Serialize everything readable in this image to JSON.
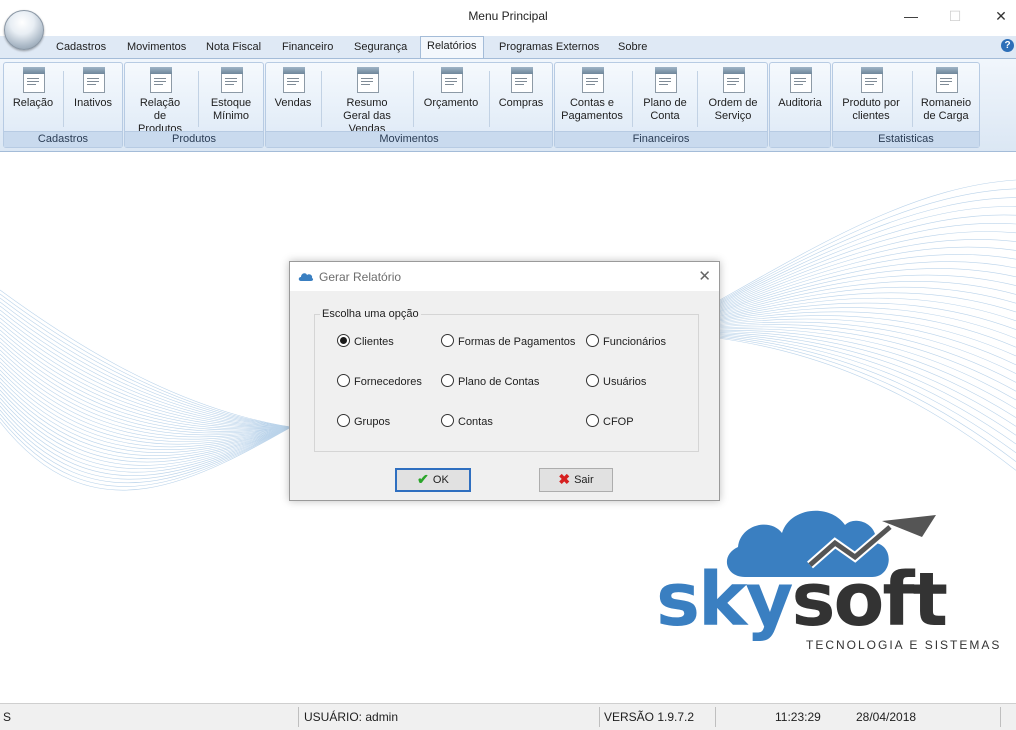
{
  "window": {
    "title": "Menu Principal"
  },
  "colors": {
    "ribbon_blue": "#dfe9f5",
    "logo_blue": "#3a7fc1",
    "logo_dark": "#333333",
    "ok_check": "#2aa52a",
    "sair_x": "#d62020"
  },
  "tabs": [
    "Cadastros",
    "Movimentos",
    "Nota Fiscal",
    "Financeiro",
    "Segurança",
    "Relatórios",
    "Programas Externos",
    "Sobre"
  ],
  "active_tab": "Relatórios",
  "ribbon": {
    "groups": [
      {
        "label": "Cadastros",
        "buttons": [
          {
            "label": "Relação"
          },
          {
            "label": "Inativos"
          }
        ]
      },
      {
        "label": "Produtos",
        "buttons": [
          {
            "label": "Relação de Produtos"
          },
          {
            "label": "Estoque Mínimo"
          }
        ]
      },
      {
        "label": "Movimentos",
        "buttons": [
          {
            "label": "Vendas"
          },
          {
            "label": "Resumo Geral das Vendas"
          },
          {
            "label": "Orçamento"
          },
          {
            "label": "Compras"
          }
        ]
      },
      {
        "label": "Financeiros",
        "buttons": [
          {
            "label": "Contas e Pagamentos"
          },
          {
            "label": "Plano de Conta"
          },
          {
            "label": "Ordem de Serviço"
          }
        ]
      },
      {
        "label": "",
        "buttons": [
          {
            "label": "Auditoria"
          }
        ]
      },
      {
        "label": "Estatisticas",
        "buttons": [
          {
            "label": "Produto por clientes"
          },
          {
            "label": "Romaneio de Carga"
          }
        ]
      }
    ]
  },
  "dialog": {
    "title": "Gerar Relatório",
    "legend": "Escolha uma opção",
    "options": [
      {
        "label": "Clientes",
        "selected": true
      },
      {
        "label": "Formas de Pagamentos",
        "selected": false
      },
      {
        "label": "Funcionários",
        "selected": false
      },
      {
        "label": "Fornecedores",
        "selected": false
      },
      {
        "label": "Plano de Contas",
        "selected": false
      },
      {
        "label": "Usuários",
        "selected": false
      },
      {
        "label": "Grupos",
        "selected": false
      },
      {
        "label": "Contas",
        "selected": false
      },
      {
        "label": "CFOP",
        "selected": false
      }
    ],
    "ok_label": "OK",
    "sair_label": "Sair"
  },
  "logo": {
    "brand_sky": "sky",
    "brand_soft": "soft",
    "tagline": "TECNOLOGIA E SISTEMAS"
  },
  "status": {
    "left": "S",
    "user": "USUÁRIO: admin",
    "version": "VERSÃO 1.9.7.2",
    "time": "11:23:29",
    "date": "28/04/2018"
  }
}
